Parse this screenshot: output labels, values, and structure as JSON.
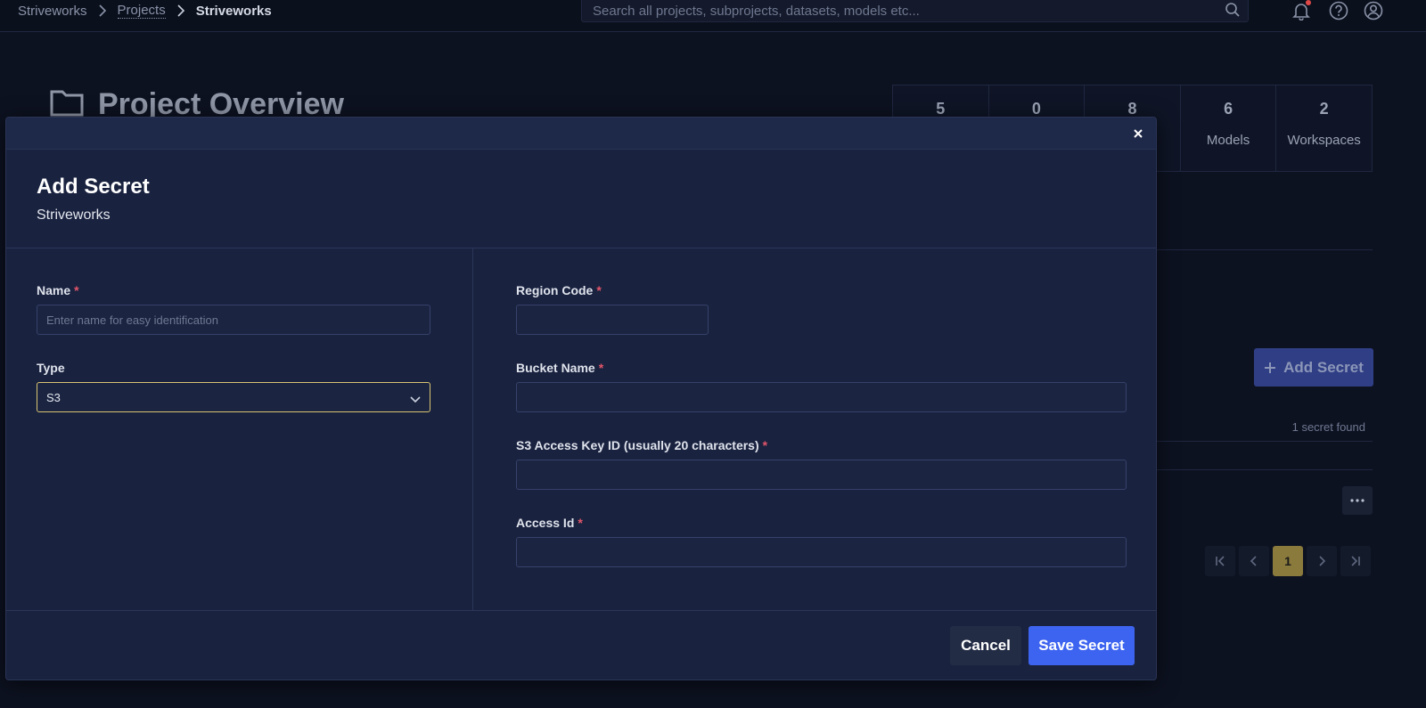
{
  "breadcrumb": {
    "items": [
      {
        "label": "Striveworks"
      },
      {
        "label": "Projects"
      },
      {
        "label": "Striveworks"
      }
    ]
  },
  "search": {
    "placeholder": "Search all projects, subprojects, datasets, models etc..."
  },
  "page": {
    "title": "Project Overview"
  },
  "stats": [
    {
      "value": "5",
      "label": ""
    },
    {
      "value": "0",
      "label": ""
    },
    {
      "value": "8",
      "label": ""
    },
    {
      "value": "6",
      "label": "Models"
    },
    {
      "value": "2",
      "label": "Workspaces"
    }
  ],
  "secrets": {
    "add_label": "Add Secret",
    "count_text": "1 secret found"
  },
  "pagination": {
    "current_page": "1"
  },
  "modal": {
    "title": "Add Secret",
    "subtitle": "Striveworks",
    "required_mark": "*",
    "name": {
      "label": "Name",
      "placeholder": "Enter name for easy identification",
      "value": ""
    },
    "type": {
      "label": "Type",
      "value": "S3"
    },
    "region_code": {
      "label": "Region Code",
      "value": ""
    },
    "bucket_name": {
      "label": "Bucket Name",
      "value": ""
    },
    "access_key_id": {
      "label": "S3 Access Key ID (usually 20 characters)",
      "value": ""
    },
    "access_id": {
      "label": "Access Id",
      "value": ""
    },
    "cancel_label": "Cancel",
    "save_label": "Save Secret"
  },
  "colors": {
    "background": "#0d1221",
    "modal_background": "#19223f",
    "primary_button": "#3d64f0",
    "focus_border": "#d9c471",
    "required": "#e2556a",
    "active_page": "#8a7a3c"
  },
  "icons": [
    "chevron-right-icon",
    "search-icon",
    "bell-icon",
    "help-icon",
    "user-icon",
    "folder-icon",
    "plus-icon",
    "more-icon",
    "first-page-icon",
    "prev-page-icon",
    "next-page-icon",
    "last-page-icon",
    "close-icon",
    "chevron-down-icon"
  ]
}
